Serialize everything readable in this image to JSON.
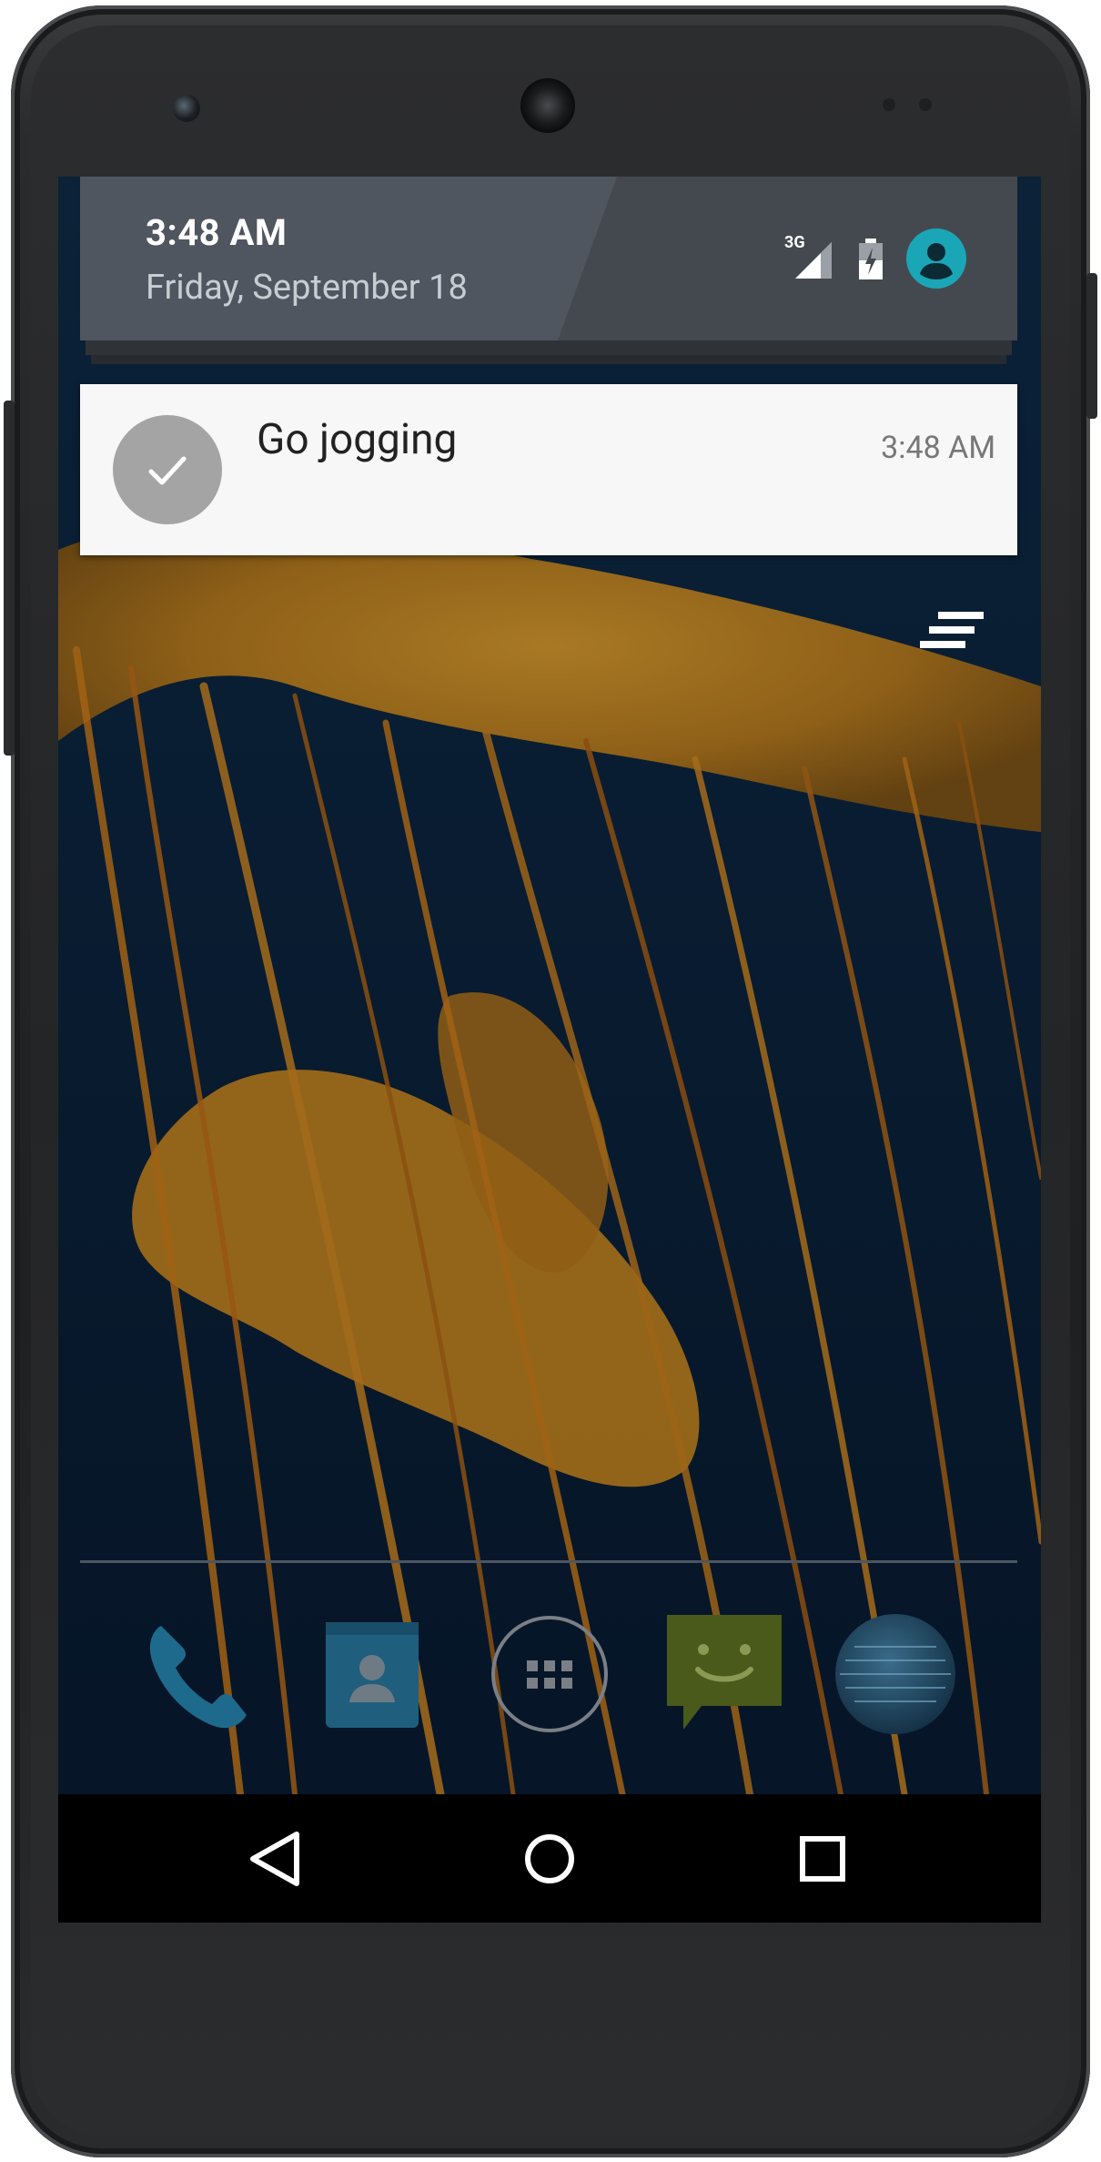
{
  "status": {
    "time": "3:48 AM",
    "date": "Friday, September 18",
    "network_label": "3G",
    "icons": [
      "signal-icon",
      "battery-icon",
      "user-avatar-icon"
    ]
  },
  "notification": {
    "title": "Go jogging",
    "time": "3:48 AM",
    "icon": "check-icon"
  },
  "actions": {
    "clear_all_icon": "clear-all-icon"
  },
  "dock": {
    "items": [
      {
        "name": "Phone",
        "icon": "phone-icon"
      },
      {
        "name": "Contacts",
        "icon": "contacts-icon"
      },
      {
        "name": "App drawer",
        "icon": "app-drawer-icon"
      },
      {
        "name": "Messaging",
        "icon": "messaging-icon"
      },
      {
        "name": "Browser",
        "icon": "globe-icon"
      }
    ]
  },
  "navbar": {
    "buttons": [
      "back-icon",
      "home-icon",
      "recents-icon"
    ]
  },
  "colors": {
    "header_bg": "#44494f",
    "avatar": "#1aa6b7",
    "notification_bg": "#f7f7f7",
    "jelly": "#c98a20"
  }
}
